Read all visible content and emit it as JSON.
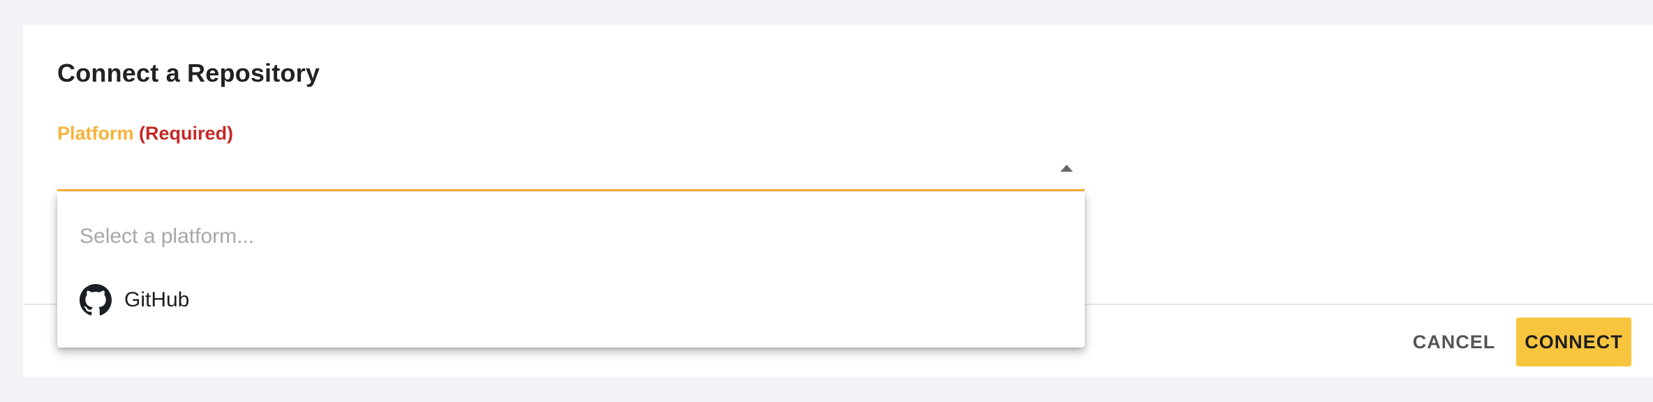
{
  "dialog": {
    "title": "Connect a Repository"
  },
  "platform_field": {
    "label": "Platform",
    "required_text": "(Required)",
    "placeholder": "Select a platform...",
    "options": [
      {
        "label": "GitHub",
        "icon": "github-icon"
      }
    ]
  },
  "actions": {
    "cancel_label": "CANCEL",
    "connect_label": "CONNECT"
  },
  "colors": {
    "accent": "#f5b33a",
    "required": "#c62828",
    "primary_button": "#f8c53f"
  }
}
